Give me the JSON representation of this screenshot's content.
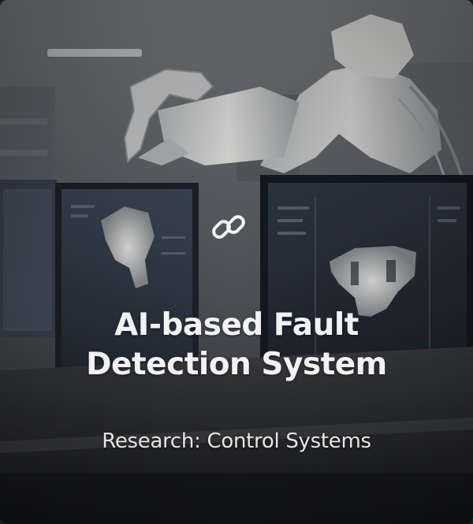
{
  "card": {
    "title_line1": "AI-based Fault",
    "title_line2": "Detection System",
    "subtitle": "Research: Control Systems",
    "link_icon": "link-icon",
    "background_image": "robotic-arm-lab-with-monitors"
  },
  "colors": {
    "title_text": "#f2f2f2",
    "subtitle_text": "#e6e6e6",
    "icon": "#f5f5f5"
  }
}
